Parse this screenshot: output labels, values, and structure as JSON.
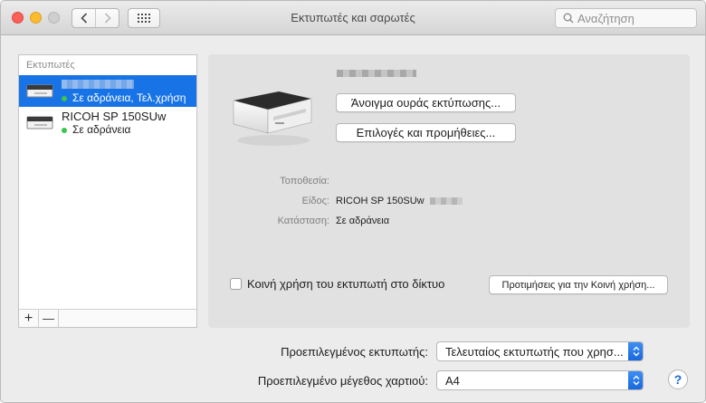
{
  "window": {
    "title": "Εκτυπωτές και σαρωτές",
    "search_placeholder": "Αναζήτηση"
  },
  "printer_list": {
    "header": "Εκτυπωτές",
    "items": [
      {
        "name": "",
        "status": "Σε αδράνεια, Τελ.χρήση",
        "selected": true
      },
      {
        "name": "RICOH SP 150SUw",
        "status": "Σε αδράνεια",
        "selected": false
      }
    ],
    "add_label": "+",
    "remove_label": "—"
  },
  "detail": {
    "open_queue_label": "Άνοιγμα ουράς εκτύπωσης...",
    "options_label": "Επιλογές και προμήθειες...",
    "location_label": "Τοποθεσία:",
    "location_value": "",
    "kind_label": "Είδος:",
    "kind_value": "RICOH SP 150SUw",
    "status_label": "Κατάσταση:",
    "status_value": "Σε αδράνεια",
    "share_label": "Κοινή χρήση του εκτυπωτή στο δίκτυο",
    "share_checked": false,
    "sharing_prefs_label": "Προτιμήσεις για την Κοινή χρήση..."
  },
  "defaults": {
    "default_printer_label": "Προεπιλεγμένος εκτυπωτής:",
    "default_printer_value": "Τελευταίος εκτυπωτής που χρησ...",
    "default_paper_label": "Προεπιλεγμένο μέγεθος χαρτιού:",
    "default_paper_value": "A4"
  },
  "help_label": "?",
  "colors": {
    "selection": "#1874e6",
    "status_idle": "#3cc44f",
    "popup_accent": "#1968de"
  }
}
